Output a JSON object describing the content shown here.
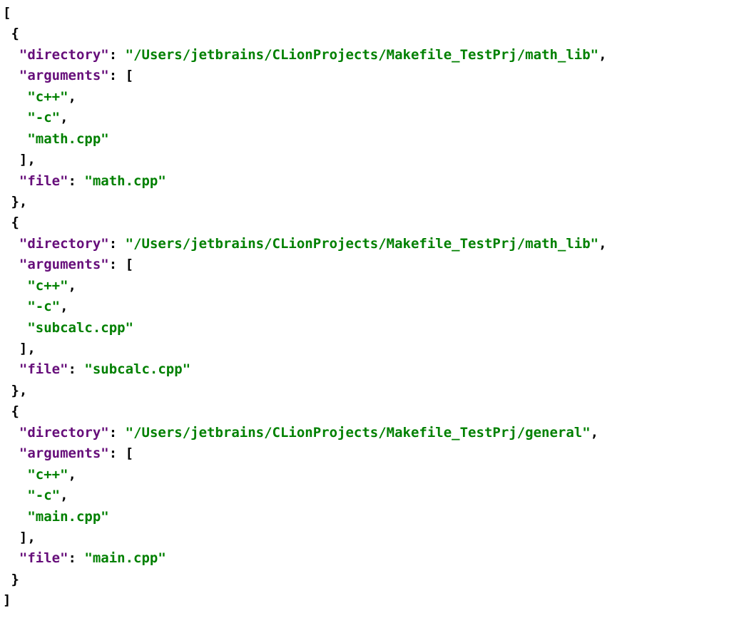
{
  "keys": {
    "directory": "\"directory\"",
    "arguments": "\"arguments\"",
    "file": "\"file\""
  },
  "entries": [
    {
      "directory": "\"/Users/jetbrains/CLionProjects/Makefile_TestPrj/math_lib\"",
      "args": [
        "\"c++\"",
        "\"-c\"",
        "\"math.cpp\""
      ],
      "file": "\"math.cpp\""
    },
    {
      "directory": "\"/Users/jetbrains/CLionProjects/Makefile_TestPrj/math_lib\"",
      "args": [
        "\"c++\"",
        "\"-c\"",
        "\"subcalc.cpp\""
      ],
      "file": "\"subcalc.cpp\""
    },
    {
      "directory": "\"/Users/jetbrains/CLionProjects/Makefile_TestPrj/general\"",
      "args": [
        "\"c++\"",
        "\"-c\"",
        "\"main.cpp\""
      ],
      "file": "\"main.cpp\""
    }
  ]
}
